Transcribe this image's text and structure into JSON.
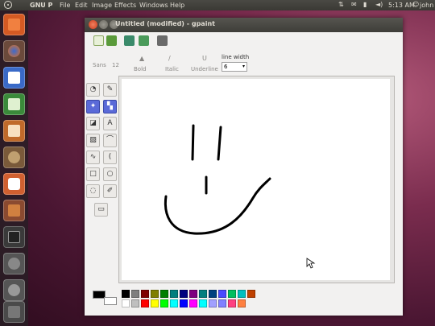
{
  "top_panel": {
    "app_name": "GNU P",
    "menus": [
      "File",
      "Edit",
      "Image",
      "Effects",
      "Windows",
      "Help"
    ],
    "time": "5:13 AM",
    "user": "john"
  },
  "launcher": {
    "items": [
      "home-folder",
      "firefox",
      "writer",
      "calc",
      "impress",
      "software-center",
      "ubuntu-one",
      "gpaint",
      "terminal",
      "workspace-switcher",
      "search",
      "trash"
    ]
  },
  "window": {
    "title": "Untitled (modified) - gpaint",
    "format": {
      "font_name": "Sans",
      "font_size": "12",
      "bold_label": "Bold",
      "italic_label": "Italic",
      "underline_label": "Underline",
      "line_width_label": "line width",
      "line_width_value": "6"
    }
  },
  "palette": [
    "#000000",
    "#7f7f7f",
    "#7f0000",
    "#7f7f00",
    "#007f00",
    "#007f7f",
    "#00007f",
    "#7f007f",
    "#007f7f",
    "#00417f",
    "#4a4aff",
    "#00bf60",
    "#00bfbf",
    "#bf4000",
    "#ffffff",
    "#bfbfbf",
    "#ff0000",
    "#ffff00",
    "#00ff00",
    "#00ffff",
    "#0000ff",
    "#ff00ff",
    "#00ffff",
    "#a0a0ff",
    "#8080ff",
    "#ff4080",
    "#ff8040"
  ]
}
